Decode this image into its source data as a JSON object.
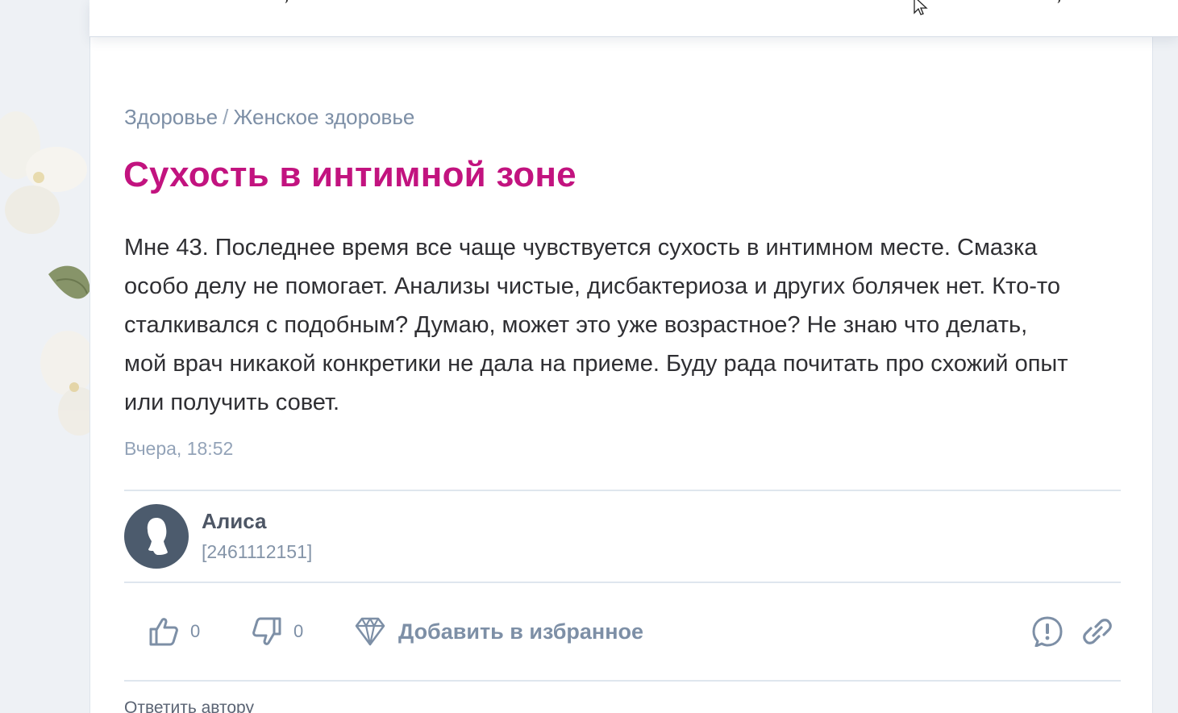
{
  "breadcrumb": {
    "parent": "Здоровье",
    "separator": "/",
    "current": "Женское здоровье"
  },
  "post": {
    "title": "Сухость в интимной зоне",
    "body": "Мне 43. Последнее время все чаще чувствуется сухость в интимном месте. Смазка особо делу не помогает. Анализы чистые, дисбактериоза и других болячек нет. Кто-то сталкивался с подобным? Думаю, может это уже возрастное? Не знаю что делать, мой врач никакой конкретики не дала на приеме. Буду рада почитать про схожий опыт или получить совет.",
    "timestamp": "Вчера, 18:52"
  },
  "author": {
    "name": "Алиса",
    "id": "[2461112151]"
  },
  "actions": {
    "likes": "0",
    "dislikes": "0",
    "favorite_label": "Добавить в избранное"
  },
  "reply": {
    "label": "Ответить автору"
  },
  "icons": {
    "like": "thumbs-up-icon",
    "dislike": "thumbs-down-icon",
    "favorite": "diamond-icon",
    "report": "exclamation-icon",
    "share": "link-icon"
  },
  "colors": {
    "title": "#c2137f",
    "muted": "#7d8fa6",
    "text": "#2f2f33",
    "avatar_bg": "#4c5b6d",
    "divider": "#dfe6ee"
  }
}
